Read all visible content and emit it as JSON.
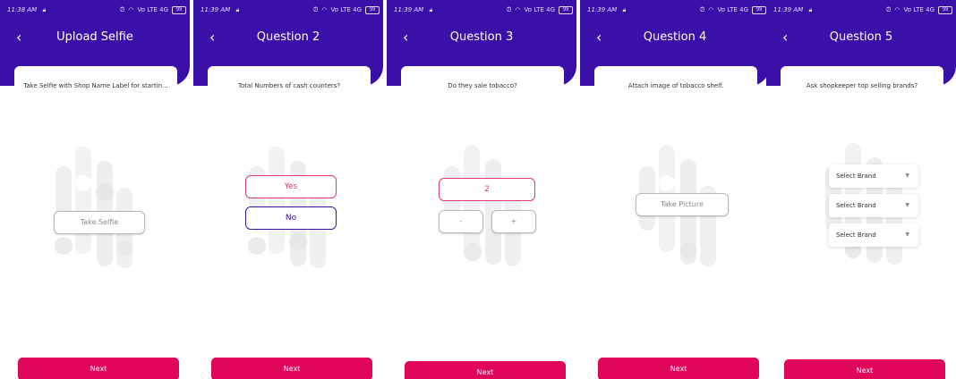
{
  "colors": {
    "primary": "#3a10a8",
    "accent": "#e0075a",
    "pink_border": "#e0357c"
  },
  "screens": [
    {
      "time": "11:38 AM",
      "title": "Upload Selfie",
      "question": "Take Selfie with Shop Name Label for startin...",
      "take_selfie_label": "Take Selfie",
      "next_label": "Next"
    },
    {
      "time": "11:39 AM",
      "title": "Question 2",
      "question": "Total Numbers of cash counters?",
      "yes_label": "Yes",
      "no_label": "No",
      "next_label": "Next"
    },
    {
      "time": "11:39 AM",
      "title": "Question 3",
      "question": "Do they sale tobacco?",
      "stepper_value": "2",
      "minus_label": "-",
      "plus_label": "+",
      "next_label": "Next"
    },
    {
      "time": "11:39 AM",
      "title": "Question 4",
      "question": "Attach image of tobacco shelf.",
      "take_picture_label": "Take Picture",
      "next_label": "Next"
    },
    {
      "time": "11:39 AM",
      "title": "Question 5",
      "question": "Ask shopkeeper top selling brands?",
      "brand_selects": [
        "Select Brand",
        "Select Brand",
        "Select Brand"
      ],
      "next_label": "Next"
    }
  ],
  "status": {
    "signal_text": "Vo LTE 4G",
    "battery": "99"
  }
}
